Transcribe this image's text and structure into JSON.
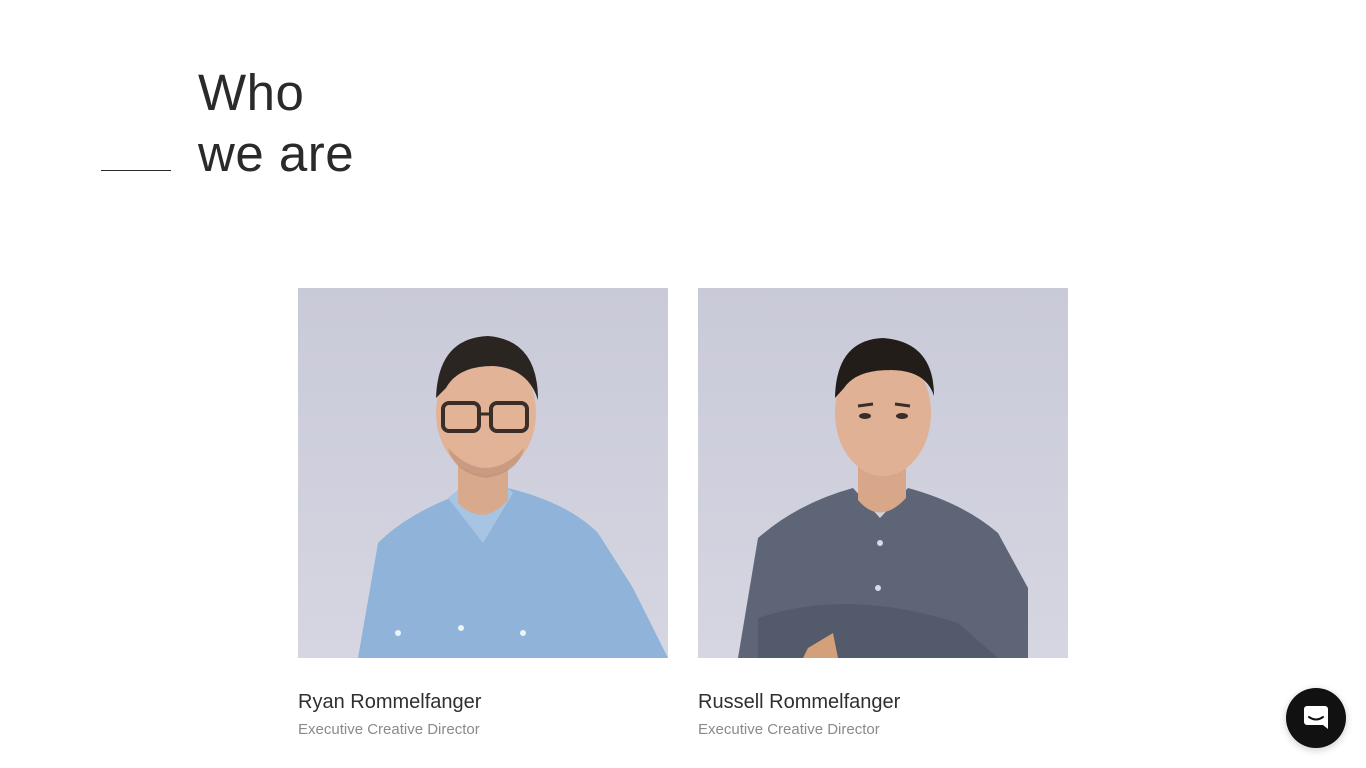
{
  "section": {
    "heading_line1": "Who",
    "heading_line2": "we are"
  },
  "team": [
    {
      "name": "Ryan Rommelfanger",
      "title": "Executive Creative Director",
      "shirt_color": "#8fb3d9"
    },
    {
      "name": "Russell Rommelfanger",
      "title": "Executive Creative Director",
      "shirt_color": "#5d6577"
    }
  ],
  "chat": {
    "icon": "chat-icon",
    "color": "#111111"
  },
  "colors": {
    "photo_background": "#cfd0dd",
    "text": "#2b2b2b",
    "subtext": "#8a8a8e"
  }
}
